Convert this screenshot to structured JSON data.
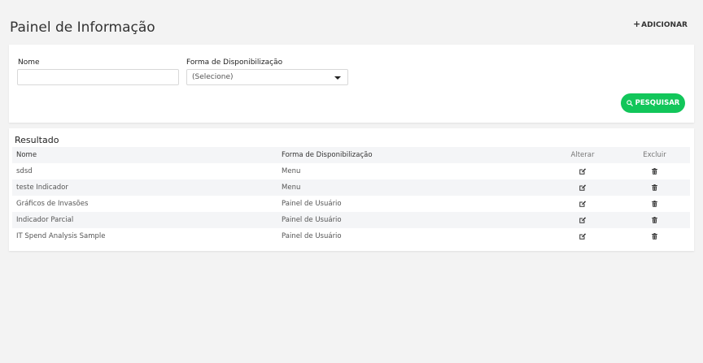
{
  "header": {
    "title": "Painel de Informação",
    "add_label": "ADICIONAR"
  },
  "filters": {
    "name_label": "Nome",
    "name_value": "",
    "form_label": "Forma de Disponibilização",
    "form_selected": "(Selecione)",
    "search_label": "PESQUISAR"
  },
  "results": {
    "title": "Resultado",
    "columns": [
      "Nome",
      "Forma de Disponibilização",
      "Alterar",
      "Excluir"
    ],
    "rows": [
      {
        "name": "sdsd",
        "form": "Menu"
      },
      {
        "name": "teste Indicador",
        "form": "Menu"
      },
      {
        "name": "Gráficos de Invasões",
        "form": "Painel de Usuário"
      },
      {
        "name": "Indicador Parcial",
        "form": "Painel de Usuário"
      },
      {
        "name": "IT Spend Analysis Sample",
        "form": "Painel de Usuário"
      }
    ]
  },
  "icons": {
    "add": "plus-icon",
    "search": "search-icon",
    "edit": "edit-icon",
    "delete": "trash-icon"
  },
  "colors": {
    "accent": "#12c65a",
    "background": "#f3f3f3",
    "row_alt": "#f4f5f7"
  }
}
